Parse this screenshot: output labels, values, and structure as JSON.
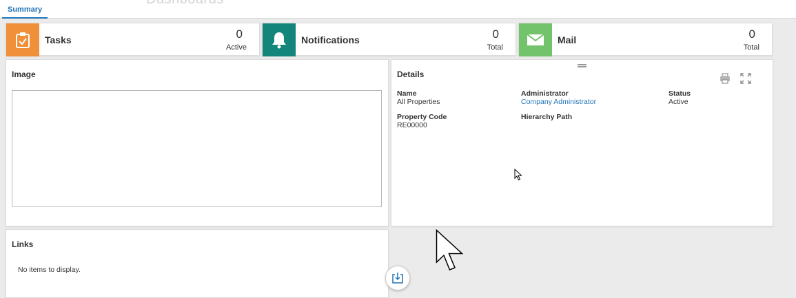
{
  "page": {
    "background_title": "Dashboards"
  },
  "tabs": [
    {
      "label": "Summary",
      "active": true
    }
  ],
  "tiles": [
    {
      "label": "Tasks",
      "count": "0",
      "sub": "Active",
      "color": "#f0903a",
      "icon": "clipboard-check-icon"
    },
    {
      "label": "Notifications",
      "count": "0",
      "sub": "Total",
      "color": "#14857a",
      "icon": "bell-icon"
    },
    {
      "label": "Mail",
      "count": "0",
      "sub": "Total",
      "color": "#72c36b",
      "icon": "envelope-icon"
    }
  ],
  "image_panel": {
    "title": "Image"
  },
  "details_panel": {
    "title": "Details",
    "tools": [
      "print-icon",
      "expand-icon"
    ],
    "fields": {
      "name": {
        "label": "Name",
        "value": "All Properties"
      },
      "administrator": {
        "label": "Administrator",
        "value": "Company Administrator"
      },
      "status": {
        "label": "Status",
        "value": "Active"
      },
      "property_code": {
        "label": "Property Code",
        "value": "RE00000"
      },
      "hierarchy_path": {
        "label": "Hierarchy Path",
        "value": ""
      }
    }
  },
  "links_panel": {
    "title": "Links",
    "empty_text": "No items to display."
  },
  "colors": {
    "accent": "#1f73b7",
    "tasks": "#f0903a",
    "notifications": "#14857a",
    "mail": "#72c36b"
  }
}
